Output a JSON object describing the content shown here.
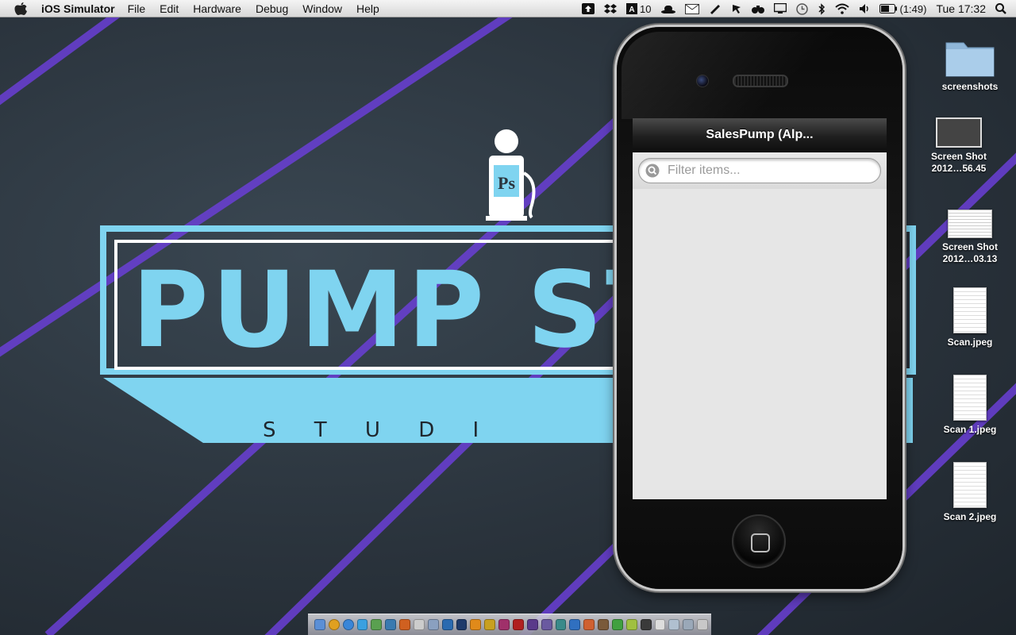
{
  "menubar": {
    "app_name": "iOS Simulator",
    "menus": [
      "File",
      "Edit",
      "Hardware",
      "Debug",
      "Window",
      "Help"
    ],
    "adobe_count": "10",
    "battery": "(1:49)",
    "clock": "Tue 17:32"
  },
  "wallpaper": {
    "logo_word": "PUMP STA",
    "logo_sub": "S T U D I",
    "pump_label": "Ps",
    "colors": {
      "logo": "#7fd4f0",
      "stripe": "#6a3fd6",
      "background": "#2b343d"
    }
  },
  "desktop_icons": [
    {
      "label": "screenshots",
      "kind": "folder"
    },
    {
      "label": "Screen Shot 2012…56.45",
      "kind": "screenshot"
    },
    {
      "label": "Screen Shot 2012…03.13",
      "kind": "screenshot"
    },
    {
      "label": "Scan.jpeg",
      "kind": "document"
    },
    {
      "label": "Scan 1.jpeg",
      "kind": "document"
    },
    {
      "label": "Scan 2.jpeg",
      "kind": "document"
    }
  ],
  "simulator": {
    "nav_title": "SalesPump (Alp...",
    "search_placeholder": "Filter items..."
  }
}
